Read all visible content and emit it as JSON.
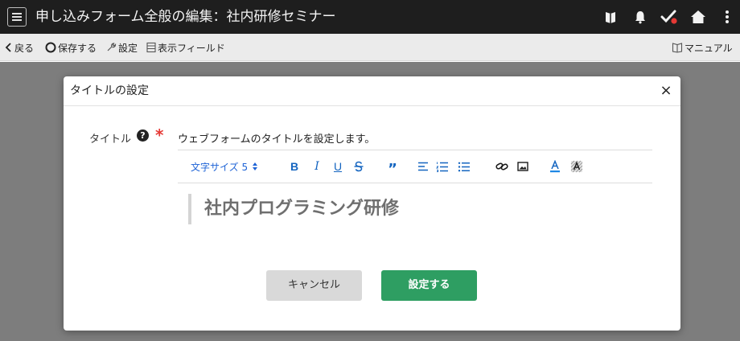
{
  "header": {
    "title": "申し込みフォーム全般の編集：社内研修セミナー",
    "icons": [
      "menu-icon",
      "notebook-icon",
      "bell-icon",
      "check-icon",
      "home-icon",
      "more-vertical-icon"
    ]
  },
  "toolbar": {
    "back_label": "戻る",
    "save_label": "保存する",
    "settings_label": "設定",
    "fields_label": "表示フィールド",
    "manual_label": "マニュアル"
  },
  "dialog": {
    "title": "タイトルの設定",
    "close_label": "×",
    "field_label": "タイトル",
    "help_label": "?",
    "required_mark": "*",
    "field_description": "ウェブフォームのタイトルを設定します。",
    "editor": {
      "font_size_label": "文字サイズ 5",
      "bold": "B",
      "italic": "I",
      "underline": "U",
      "quote": "”",
      "content": "社内プログラミング研修"
    },
    "cancel_label": "キャンセル",
    "submit_label": "設定する"
  },
  "colors": {
    "header_bg": "#1e1e1e",
    "accent_red": "#e53935",
    "submit_green": "#2e9e62",
    "link_blue": "#1e63d6"
  }
}
